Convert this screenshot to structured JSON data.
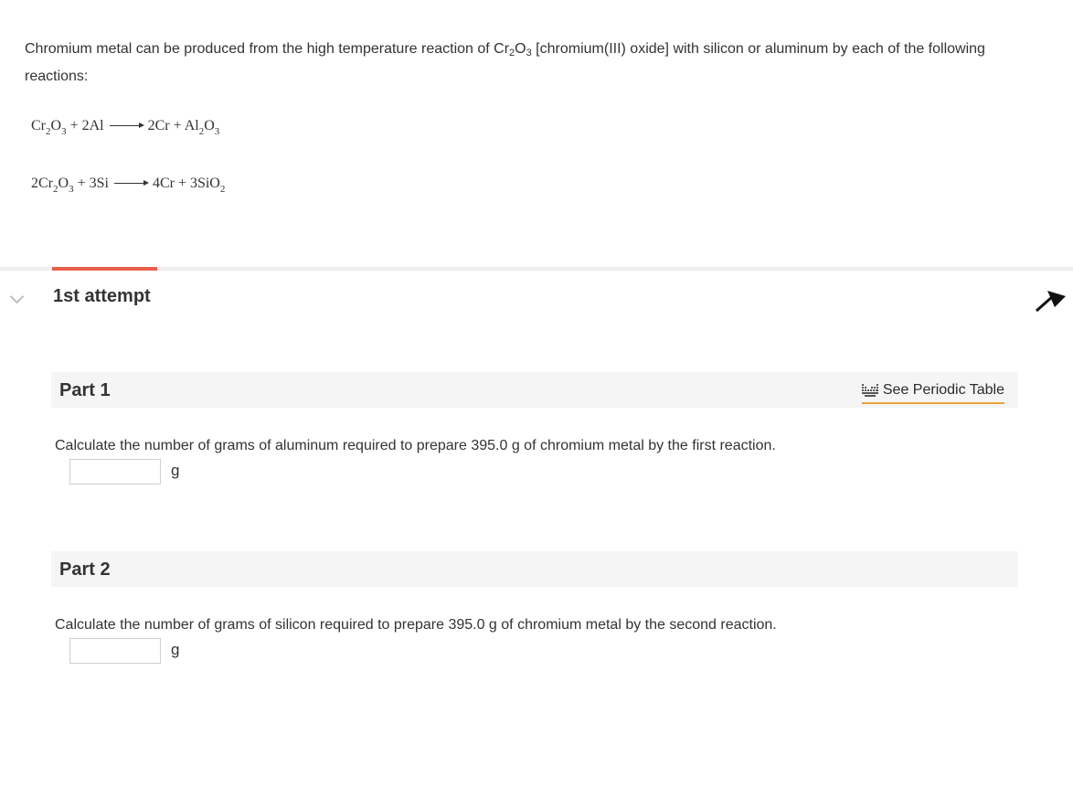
{
  "intro": {
    "before": "Chromium metal can be produced from the high temperature reaction of Cr",
    "sub1": "2",
    "mid": "O",
    "sub2": "3",
    "after": " [chromium(III) oxide] with silicon or aluminum by each of the following reactions:"
  },
  "equations": [
    {
      "left": [
        {
          "t": "Cr"
        },
        {
          "s": "2"
        },
        {
          "t": "O"
        },
        {
          "s": "3"
        },
        {
          "t": " + 2Al"
        }
      ],
      "right": [
        {
          "t": "2Cr + Al"
        },
        {
          "s": "2"
        },
        {
          "t": "O"
        },
        {
          "s": "3"
        }
      ]
    },
    {
      "left": [
        {
          "t": "2Cr"
        },
        {
          "s": "2"
        },
        {
          "t": "O"
        },
        {
          "s": "3"
        },
        {
          "t": " + 3Si"
        }
      ],
      "right": [
        {
          "t": "4Cr + 3SiO"
        },
        {
          "s": "2"
        }
      ]
    }
  ],
  "attempt": {
    "label": "1st attempt"
  },
  "periodic_table": {
    "label": "See Periodic Table"
  },
  "parts": [
    {
      "title": "Part 1",
      "question": "Calculate the number of grams of aluminum required to prepare 395.0 g of chromium metal by the first reaction.",
      "answer_value": "",
      "unit": "g"
    },
    {
      "title": "Part 2",
      "question": "Calculate the number of grams of silicon required to prepare 395.0 g of chromium metal by the second reaction.",
      "answer_value": "",
      "unit": "g"
    }
  ],
  "colors": {
    "accent": "#e8604c",
    "link_underline": "#e8a23a",
    "header_bg": "#f5f5f5"
  },
  "icons": {
    "attempt_toggle": "chevron-down-icon",
    "periodic_table": "periodic-table-icon",
    "cursor": "mouse-pointer-icon"
  }
}
